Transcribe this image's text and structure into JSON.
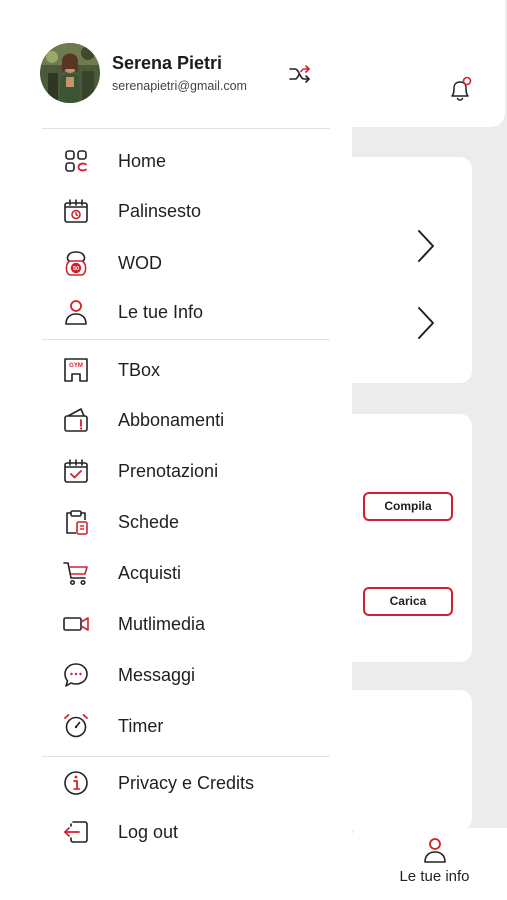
{
  "colors": {
    "accent": "#d2202f",
    "ink": "#222222",
    "bg": "#ececec"
  },
  "profile": {
    "name": "Serena Pietri",
    "email": "serenapietri@gmail.com"
  },
  "menu": [
    {
      "id": "home",
      "label": "Home",
      "icon": "home-icon"
    },
    {
      "id": "palinsesto",
      "label": "Palinsesto",
      "icon": "calendar-icon"
    },
    {
      "id": "wod",
      "label": "WOD",
      "icon": "kettlebell-icon"
    },
    {
      "id": "le-tue-info",
      "label": "Le tue Info",
      "icon": "user-icon"
    },
    {
      "id": "tbox",
      "label": "TBox",
      "icon": "gym-icon"
    },
    {
      "id": "abbonamenti",
      "label": "Abbonamenti",
      "icon": "subscription-icon"
    },
    {
      "id": "prenotazioni",
      "label": "Prenotazioni",
      "icon": "calendar-check-icon"
    },
    {
      "id": "schede",
      "label": "Schede",
      "icon": "clipboard-icon"
    },
    {
      "id": "acquisti",
      "label": "Acquisti",
      "icon": "cart-icon"
    },
    {
      "id": "multimedia",
      "label": "Mutlimedia",
      "icon": "video-icon"
    },
    {
      "id": "messaggi",
      "label": "Messaggi",
      "icon": "chat-icon"
    },
    {
      "id": "timer",
      "label": "Timer",
      "icon": "timer-icon"
    },
    {
      "id": "privacy",
      "label": "Privacy e Credits",
      "icon": "info-icon"
    },
    {
      "id": "logout",
      "label": "Log out",
      "icon": "logout-icon"
    }
  ],
  "background": {
    "buttons": {
      "compila": "Compila",
      "carica": "Carica"
    },
    "bottom_nav": {
      "label": "Le tue info"
    }
  }
}
